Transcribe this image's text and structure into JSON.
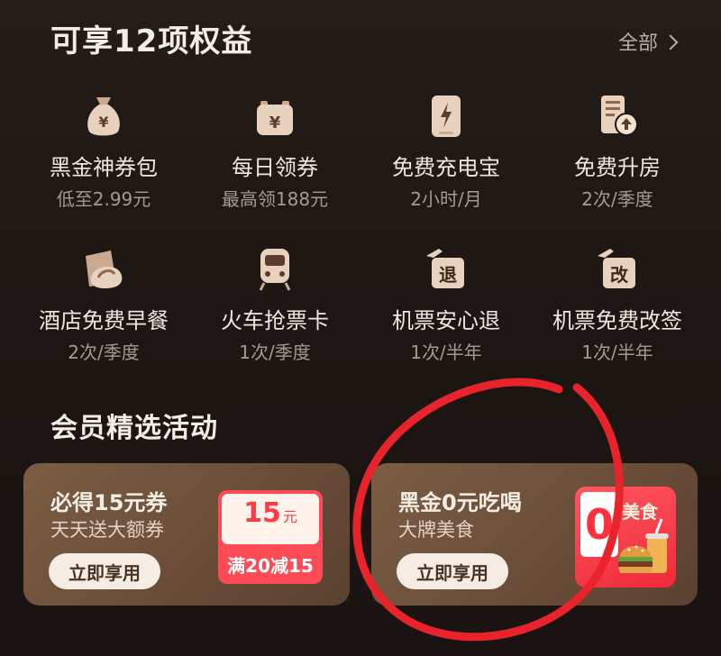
{
  "header": {
    "title": "可享12项权益",
    "all_label": "全部"
  },
  "benefits": [
    {
      "name": "黑金神券包",
      "sub": "低至2.99元",
      "icon": "money-bag-icon"
    },
    {
      "name": "每日领券",
      "sub": "最高领188元",
      "icon": "calendar-coupon-icon"
    },
    {
      "name": "免费充电宝",
      "sub": "2小时/月",
      "icon": "power-bank-icon"
    },
    {
      "name": "免费升房",
      "sub": "2次/季度",
      "icon": "room-upgrade-icon"
    },
    {
      "name": "酒店免费早餐",
      "sub": "2次/季度",
      "icon": "breakfast-icon"
    },
    {
      "name": "火车抢票卡",
      "sub": "1次/季度",
      "icon": "train-icon"
    },
    {
      "name": "机票安心退",
      "sub": "1次/半年",
      "icon": "flight-refund-icon",
      "glyph": "退"
    },
    {
      "name": "机票免费改签",
      "sub": "1次/半年",
      "icon": "flight-change-icon",
      "glyph": "改"
    }
  ],
  "activities": {
    "title": "会员精选活动",
    "cards": [
      {
        "title": "必得15元券",
        "sub": "天天送大额券",
        "button": "立即享用",
        "coupon": {
          "amount": "15",
          "unit": "元",
          "rule": "满20减15"
        }
      },
      {
        "title": "黑金0元吃喝",
        "sub": "大牌美食",
        "button": "立即享用",
        "badge": {
          "zero": "0",
          "tag": "美食"
        }
      }
    ]
  },
  "colors": {
    "accent": "#ff3a45",
    "card": "#6a4e39",
    "icon": "#e9d2bd"
  }
}
